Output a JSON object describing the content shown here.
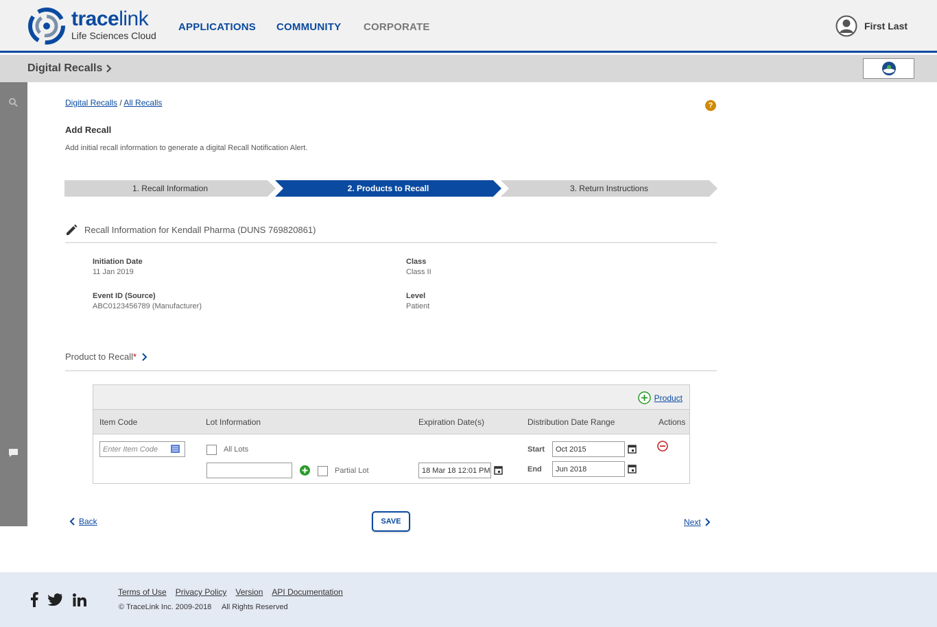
{
  "header": {
    "logo_text_bold": "trace",
    "logo_text_thin": "link",
    "logo_subtitle": "Life Sciences Cloud",
    "nav": [
      "APPLICATIONS",
      "COMMUNITY",
      "CORPORATE"
    ],
    "user_name": "First Last"
  },
  "subheader": {
    "title": "Digital Recalls"
  },
  "breadcrumb": {
    "root": "Digital Recalls",
    "sep": "/",
    "current": "All Recalls"
  },
  "help_icon": "?",
  "page": {
    "title": "Add Recall",
    "description": "Add initial recall information to generate a digital Recall Notification Alert."
  },
  "steps": [
    "1. Recall Information",
    "2. Products to Recall",
    "3. Return Instructions"
  ],
  "recall_info": {
    "heading": "Recall Information for Kendall Pharma (DUNS 769820861)",
    "fields": [
      {
        "label": "Initiation Date",
        "value": "11 Jan 2019"
      },
      {
        "label": "Class",
        "value": "Class II"
      },
      {
        "label": "Event ID (Source)",
        "value": "ABC0123456789 (Manufacturer)"
      },
      {
        "label": "Level",
        "value": "Patient"
      }
    ]
  },
  "product_section": {
    "heading": "Product to Recall",
    "required_mark": "*",
    "add_product": "Product",
    "columns": [
      "Item Code",
      "Lot Information",
      "Expiration Date(s)",
      "Distribution Date Range",
      "Actions"
    ],
    "row": {
      "item_code_placeholder": "Enter Item Code",
      "all_lots_label": "All Lots",
      "lot_value": "",
      "partial_lot_label": "Partial Lot",
      "expiration": "18 Mar 18 12:01 PM",
      "start_label": "Start",
      "start_value": "Oct 2015",
      "end_label": "End",
      "end_value": "Jun 2018"
    }
  },
  "actions": {
    "back": "Back",
    "save": "SAVE",
    "next": "Next"
  },
  "footer": {
    "links": [
      "Terms of Use",
      "Privacy Policy",
      "Version",
      "API Documentation"
    ],
    "copyright": "© TraceLink Inc. 2009-2018     All Rights Reserved"
  },
  "colors": {
    "brand_blue": "#0a4aa0",
    "help_orange": "#d08a00",
    "add_green": "#2a9a2a",
    "remove_red": "#c62828"
  }
}
